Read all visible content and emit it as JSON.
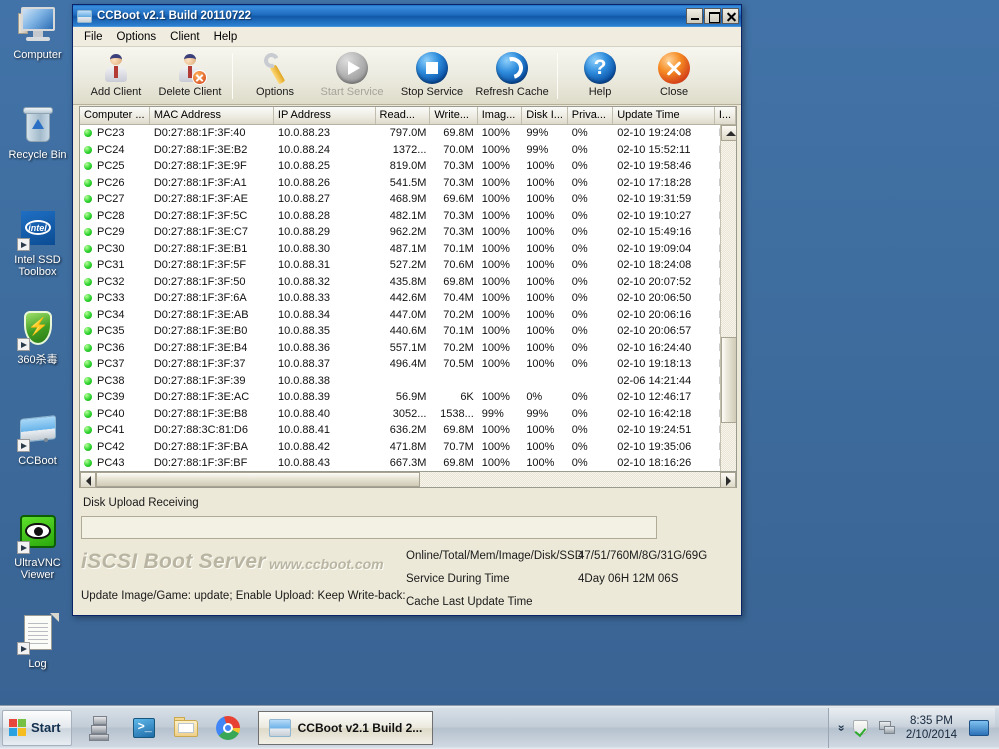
{
  "desktop": {
    "icons": [
      {
        "label": "Computer",
        "icon": "computer-icon"
      },
      {
        "label": "Recycle Bin",
        "icon": "recycle-bin-icon"
      },
      {
        "label": "Intel SSD Toolbox",
        "icon": "intel-ssd-toolbox-icon",
        "brand": "intel"
      },
      {
        "label": "360杀毒",
        "icon": "360-antivirus-shield-icon"
      },
      {
        "label": "CCBoot",
        "icon": "ccboot-disk-icon"
      },
      {
        "label": "UltraVNC Viewer",
        "icon": "ultravnc-eye-icon"
      },
      {
        "label": "Log",
        "icon": "log-document-icon"
      }
    ]
  },
  "window": {
    "title": "CCBoot v2.1 Build 20110722",
    "buttons": {
      "minimize": "Minimize",
      "maximize": "Maximize",
      "close": "Close"
    },
    "menu": [
      "File",
      "Options",
      "Client",
      "Help"
    ],
    "toolbar": [
      {
        "label": "Add Client",
        "icon": "add-client-icon",
        "disabled": false
      },
      {
        "label": "Delete Client",
        "icon": "delete-client-icon",
        "disabled": false
      },
      {
        "label": "Options",
        "icon": "options-wrench-icon",
        "disabled": false
      },
      {
        "label": "Start Service",
        "icon": "start-service-icon",
        "disabled": true
      },
      {
        "label": "Stop Service",
        "icon": "stop-service-icon",
        "disabled": false
      },
      {
        "label": "Refresh Cache",
        "icon": "refresh-cache-icon",
        "disabled": false
      },
      {
        "label": "Help",
        "icon": "help-icon",
        "disabled": false
      },
      {
        "label": "Close",
        "icon": "close-icon",
        "disabled": false
      }
    ]
  },
  "table": {
    "columns": [
      "Computer ...",
      "MAC Address",
      "IP Address",
      "Read...",
      "Write...",
      "Imag...",
      "Disk I...",
      "Priva...",
      "Update Time",
      "I..."
    ],
    "rows": [
      {
        "status": "online",
        "name": "PC23",
        "mac": "D0:27:88:1F:3F:40",
        "ip": "10.0.88.23",
        "read": "797.0M",
        "write": "69.8M",
        "image": "100%",
        "disk": "99%",
        "priv": "0%",
        "updated": "02-10 19:24:08",
        "last": "E"
      },
      {
        "status": "online",
        "name": "PC24",
        "mac": "D0:27:88:1F:3E:B2",
        "ip": "10.0.88.24",
        "read": "1372...",
        "write": "70.0M",
        "image": "100%",
        "disk": "99%",
        "priv": "0%",
        "updated": "02-10 15:52:11",
        "last": "E"
      },
      {
        "status": "online",
        "name": "PC25",
        "mac": "D0:27:88:1F:3E:9F",
        "ip": "10.0.88.25",
        "read": "819.0M",
        "write": "70.3M",
        "image": "100%",
        "disk": "100%",
        "priv": "0%",
        "updated": "02-10 19:58:46",
        "last": "E"
      },
      {
        "status": "online",
        "name": "PC26",
        "mac": "D0:27:88:1F:3F:A1",
        "ip": "10.0.88.26",
        "read": "541.5M",
        "write": "70.3M",
        "image": "100%",
        "disk": "100%",
        "priv": "0%",
        "updated": "02-10 17:18:28",
        "last": "E"
      },
      {
        "status": "online",
        "name": "PC27",
        "mac": "D0:27:88:1F:3F:AE",
        "ip": "10.0.88.27",
        "read": "468.9M",
        "write": "69.6M",
        "image": "100%",
        "disk": "100%",
        "priv": "0%",
        "updated": "02-10 19:31:59",
        "last": "E"
      },
      {
        "status": "online",
        "name": "PC28",
        "mac": "D0:27:88:1F:3F:5C",
        "ip": "10.0.88.28",
        "read": "482.1M",
        "write": "70.3M",
        "image": "100%",
        "disk": "100%",
        "priv": "0%",
        "updated": "02-10 19:10:27",
        "last": "E"
      },
      {
        "status": "online",
        "name": "PC29",
        "mac": "D0:27:88:1F:3E:C7",
        "ip": "10.0.88.29",
        "read": "962.2M",
        "write": "70.3M",
        "image": "100%",
        "disk": "100%",
        "priv": "0%",
        "updated": "02-10 15:49:16",
        "last": "E"
      },
      {
        "status": "online",
        "name": "PC30",
        "mac": "D0:27:88:1F:3E:B1",
        "ip": "10.0.88.30",
        "read": "487.1M",
        "write": "70.1M",
        "image": "100%",
        "disk": "100%",
        "priv": "0%",
        "updated": "02-10 19:09:04",
        "last": "E"
      },
      {
        "status": "online",
        "name": "PC31",
        "mac": "D0:27:88:1F:3F:5F",
        "ip": "10.0.88.31",
        "read": "527.2M",
        "write": "70.6M",
        "image": "100%",
        "disk": "100%",
        "priv": "0%",
        "updated": "02-10 18:24:08",
        "last": "E"
      },
      {
        "status": "online",
        "name": "PC32",
        "mac": "D0:27:88:1F:3F:50",
        "ip": "10.0.88.32",
        "read": "435.8M",
        "write": "69.8M",
        "image": "100%",
        "disk": "100%",
        "priv": "0%",
        "updated": "02-10 20:07:52",
        "last": "E"
      },
      {
        "status": "online",
        "name": "PC33",
        "mac": "D0:27:88:1F:3F:6A",
        "ip": "10.0.88.33",
        "read": "442.6M",
        "write": "70.4M",
        "image": "100%",
        "disk": "100%",
        "priv": "0%",
        "updated": "02-10 20:06:50",
        "last": "E"
      },
      {
        "status": "online",
        "name": "PC34",
        "mac": "D0:27:88:1F:3E:AB",
        "ip": "10.0.88.34",
        "read": "447.0M",
        "write": "70.2M",
        "image": "100%",
        "disk": "100%",
        "priv": "0%",
        "updated": "02-10 20:06:16",
        "last": "E"
      },
      {
        "status": "online",
        "name": "PC35",
        "mac": "D0:27:88:1F:3E:B0",
        "ip": "10.0.88.35",
        "read": "440.6M",
        "write": "70.1M",
        "image": "100%",
        "disk": "100%",
        "priv": "0%",
        "updated": "02-10 20:06:57",
        "last": "E"
      },
      {
        "status": "online",
        "name": "PC36",
        "mac": "D0:27:88:1F:3E:B4",
        "ip": "10.0.88.36",
        "read": "557.1M",
        "write": "70.2M",
        "image": "100%",
        "disk": "100%",
        "priv": "0%",
        "updated": "02-10 16:24:40",
        "last": "E"
      },
      {
        "status": "online",
        "name": "PC37",
        "mac": "D0:27:88:1F:3F:37",
        "ip": "10.0.88.37",
        "read": "496.4M",
        "write": "70.5M",
        "image": "100%",
        "disk": "100%",
        "priv": "0%",
        "updated": "02-10 19:18:13",
        "last": "E"
      },
      {
        "status": "online",
        "name": "PC38",
        "mac": "D0:27:88:1F:3F:39",
        "ip": "10.0.88.38",
        "read": "",
        "write": "",
        "image": "",
        "disk": "",
        "priv": "",
        "updated": "02-06 14:21:44",
        "last": "E"
      },
      {
        "status": "online",
        "name": "PC39",
        "mac": "D0:27:88:1F:3E:AC",
        "ip": "10.0.88.39",
        "read": "56.9M",
        "write": "6K",
        "image": "100%",
        "disk": "0%",
        "priv": "0%",
        "updated": "02-10 12:46:17",
        "last": "E"
      },
      {
        "status": "online",
        "name": "PC40",
        "mac": "D0:27:88:1F:3E:B8",
        "ip": "10.0.88.40",
        "read": "3052...",
        "write": "1538...",
        "image": "99%",
        "disk": "99%",
        "priv": "0%",
        "updated": "02-10 16:42:18",
        "last": "E"
      },
      {
        "status": "online",
        "name": "PC41",
        "mac": "D0:27:88:3C:81:D6",
        "ip": "10.0.88.41",
        "read": "636.2M",
        "write": "69.8M",
        "image": "100%",
        "disk": "100%",
        "priv": "0%",
        "updated": "02-10 19:24:51",
        "last": "E"
      },
      {
        "status": "online",
        "name": "PC42",
        "mac": "D0:27:88:1F:3F:BA",
        "ip": "10.0.88.42",
        "read": "471.8M",
        "write": "70.7M",
        "image": "100%",
        "disk": "100%",
        "priv": "0%",
        "updated": "02-10 19:35:06",
        "last": "E"
      },
      {
        "status": "online",
        "name": "PC43",
        "mac": "D0:27:88:1F:3F:BF",
        "ip": "10.0.88.43",
        "read": "667.3M",
        "write": "69.8M",
        "image": "100%",
        "disk": "100%",
        "priv": "0%",
        "updated": "02-10 18:16:26",
        "last": "E"
      }
    ]
  },
  "status": {
    "upload_label": "Disk Upload Receiving",
    "brand": "iSCSI Boot Server",
    "url": "www.ccboot.com",
    "bottom_options": "Update Image/Game: update; Enable Upload:  Keep Write-back:",
    "info": [
      {
        "key": "Online/Total/Mem/Image/Disk/SSD",
        "value": "47/51/760M/8G/31G/69G"
      },
      {
        "key": "Service During Time",
        "value": "4Day 06H 12M 06S"
      },
      {
        "key": "Cache Last Update Time",
        "value": ""
      }
    ]
  },
  "taskbar": {
    "start_label": "Start",
    "quicklaunch": [
      {
        "name": "server-manager-icon"
      },
      {
        "name": "powershell-icon"
      },
      {
        "name": "file-explorer-icon"
      },
      {
        "name": "chrome-icon"
      }
    ],
    "tasks": [
      {
        "label": "CCBoot v2.1 Build 2...",
        "icon": "ccboot-disk-icon"
      }
    ],
    "tray": {
      "chevron": "«",
      "icons": [
        "action-center-shield-icon",
        "network-icon"
      ],
      "time": "8:35 PM",
      "date": "2/10/2014"
    }
  },
  "colors": {
    "desktop": "#3a6ea5",
    "title_blue": "#1e6bbf",
    "chrome_face": "#ece9d8",
    "status_green": "#2fd42f",
    "brand_gray": "#b9b5a2"
  }
}
